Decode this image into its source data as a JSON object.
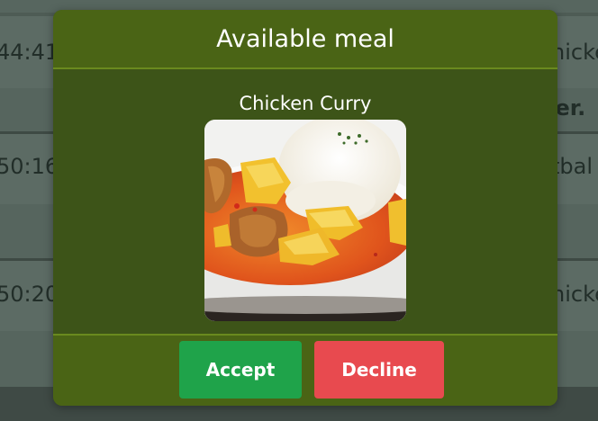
{
  "background_rows": [
    {
      "time": "44:41",
      "item": "hicke",
      "note": "fer."
    },
    {
      "time": "50:16",
      "item": "tbal",
      "note": ""
    },
    {
      "time": "50:20",
      "item": "hicke",
      "note": ""
    }
  ],
  "modal": {
    "title": "Available meal",
    "meal_name": "Chicken Curry",
    "meal_image_alt": "chicken-curry-photo",
    "accept_label": "Accept",
    "decline_label": "Decline"
  },
  "colors": {
    "modal_body": "#3d5418",
    "modal_header": "#4a6415",
    "accept": "#1fa34a",
    "decline": "#e84a4f"
  }
}
